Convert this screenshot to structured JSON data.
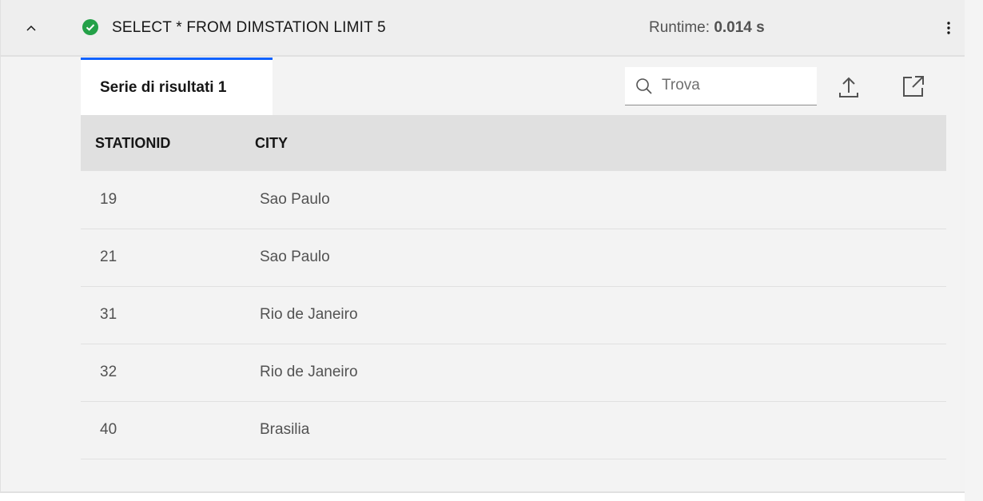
{
  "query": {
    "text": "SELECT * FROM DIMSTATION LIMIT 5",
    "status": "success",
    "status_color": "#24a148"
  },
  "runtime": {
    "label": "Runtime:",
    "value": "0.014 s"
  },
  "tabs": [
    {
      "label": "Serie di risultati 1",
      "active": true
    }
  ],
  "search": {
    "placeholder": "Trova",
    "value": ""
  },
  "table": {
    "columns": [
      "STATIONID",
      "CITY"
    ],
    "rows": [
      {
        "stationid": "19",
        "city": "Sao Paulo"
      },
      {
        "stationid": "21",
        "city": "Sao Paulo"
      },
      {
        "stationid": "31",
        "city": "Rio de Janeiro"
      },
      {
        "stationid": "32",
        "city": "Rio de Janeiro"
      },
      {
        "stationid": "40",
        "city": "Brasilia"
      }
    ]
  },
  "colors": {
    "accent": "#0f62fe"
  }
}
